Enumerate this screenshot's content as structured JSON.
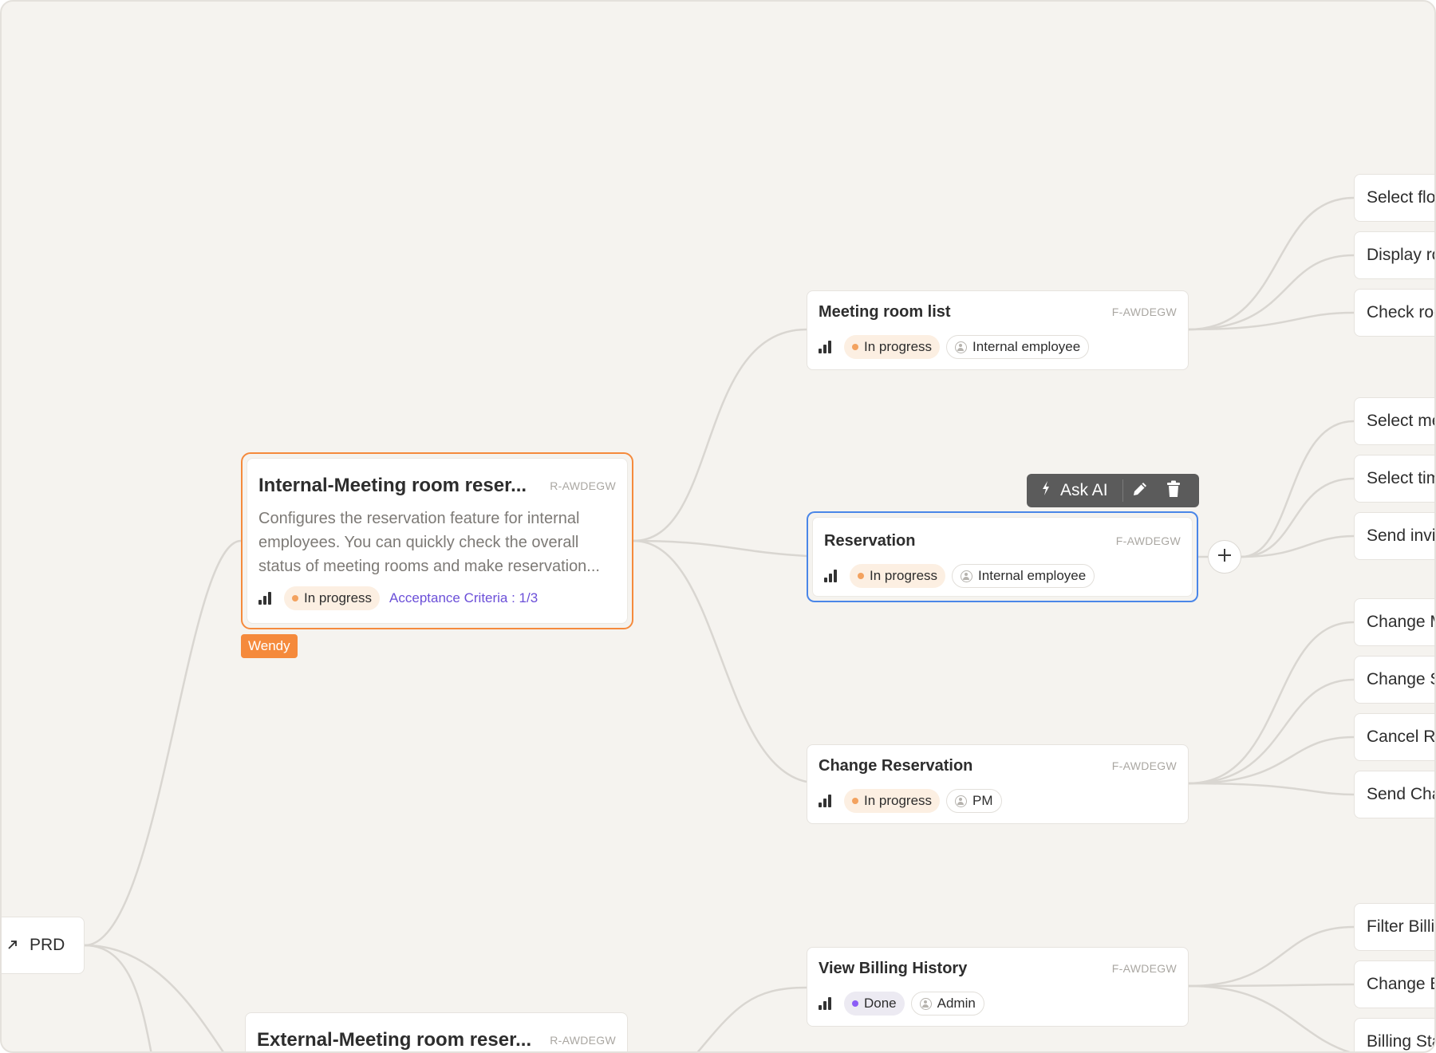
{
  "root": {
    "label": "PRD"
  },
  "requirement": {
    "title": "Internal-Meeting room reser...",
    "code": "R-AWDEGW",
    "description": "Configures the reservation feature for internal employees. You can quickly check the overall status of meeting rooms and make reservation...",
    "status": "In progress",
    "acceptance": "Acceptance Criteria : 1/3",
    "assignee_tag": "Wendy"
  },
  "external_requirement": {
    "title": "External-Meeting room reser...",
    "code": "R-AWDEGW"
  },
  "toolbar": {
    "ask_ai": "Ask AI"
  },
  "features": [
    {
      "title": "Meeting room list",
      "code": "F-AWDEGW",
      "status": "In progress",
      "role": "Internal employee"
    },
    {
      "title": "Reservation",
      "code": "F-AWDEGW",
      "status": "In progress",
      "role": "Internal employee"
    },
    {
      "title": "Change Reservation",
      "code": "F-AWDEGW",
      "status": "In progress",
      "role": "PM"
    },
    {
      "title": "View Billing History",
      "code": "F-AWDEGW",
      "status": "Done",
      "role": "Admin"
    }
  ],
  "leaves": [
    "Select flo",
    "Display ro",
    "Check roo",
    "Select me",
    "Select tim",
    "Send invi",
    "Change M",
    "Change S",
    "Cancel Re",
    "Send Cha",
    "Filter Billin",
    "Change B",
    "Billing Sta"
  ],
  "colors": {
    "background": "#f5f3ef",
    "selected_border": "#4a86e8",
    "focus_border": "#f58a3c",
    "status_in_progress": "#f3a25f",
    "status_done": "#8b5cf6",
    "acceptance_link": "#6b4fd8"
  }
}
